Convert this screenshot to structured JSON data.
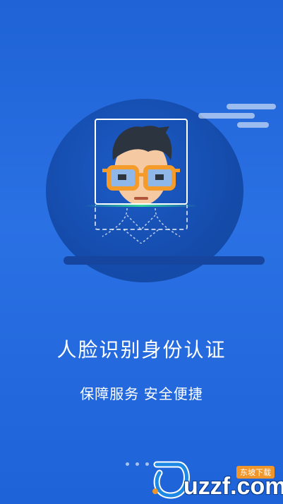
{
  "onboarding": {
    "title": "人脸识别身份认证",
    "subtitle": "保障服务 安全便捷",
    "page_indicator": {
      "total": 4,
      "active_index": 3
    }
  },
  "illustration": {
    "avatar_icon": "face-scan-icon",
    "colors": {
      "background": "#2066da",
      "circle": "#1550b0",
      "scan_line": "#34d399",
      "glasses": "#f59b2a",
      "hair": "#2c3440",
      "skin": "#f5c9a1"
    }
  },
  "watermark": {
    "text": "uzzf.com",
    "badge": "东坡下载"
  }
}
